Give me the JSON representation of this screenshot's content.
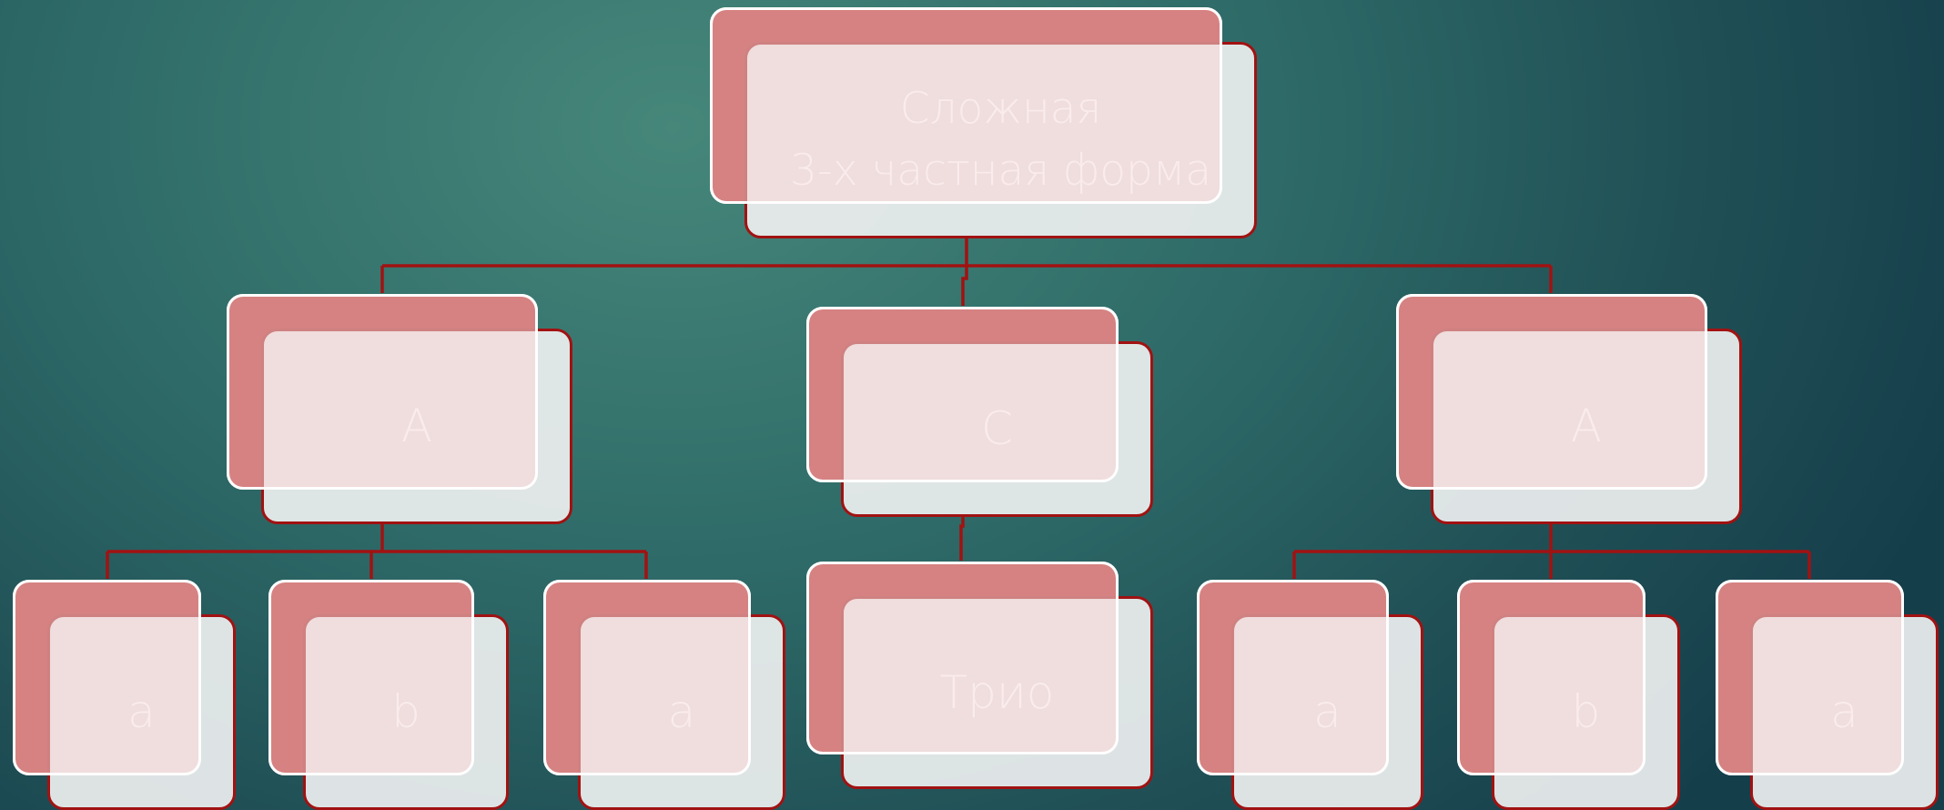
{
  "diagram": {
    "root": {
      "label": "Сложная\n3-х частная форма"
    },
    "sections": [
      {
        "label": "A",
        "children": [
          {
            "label": "a"
          },
          {
            "label": "b"
          },
          {
            "label": "a"
          }
        ]
      },
      {
        "label": "C",
        "children": [
          {
            "label": "Трио"
          }
        ]
      },
      {
        "label": "A",
        "children": [
          {
            "label": "a"
          },
          {
            "label": "b"
          },
          {
            "label": "a"
          }
        ]
      }
    ]
  },
  "colors": {
    "box_red": "#b01414",
    "box_light": "#eef0f0",
    "connector": "#a11212",
    "text": "#ffffff"
  }
}
